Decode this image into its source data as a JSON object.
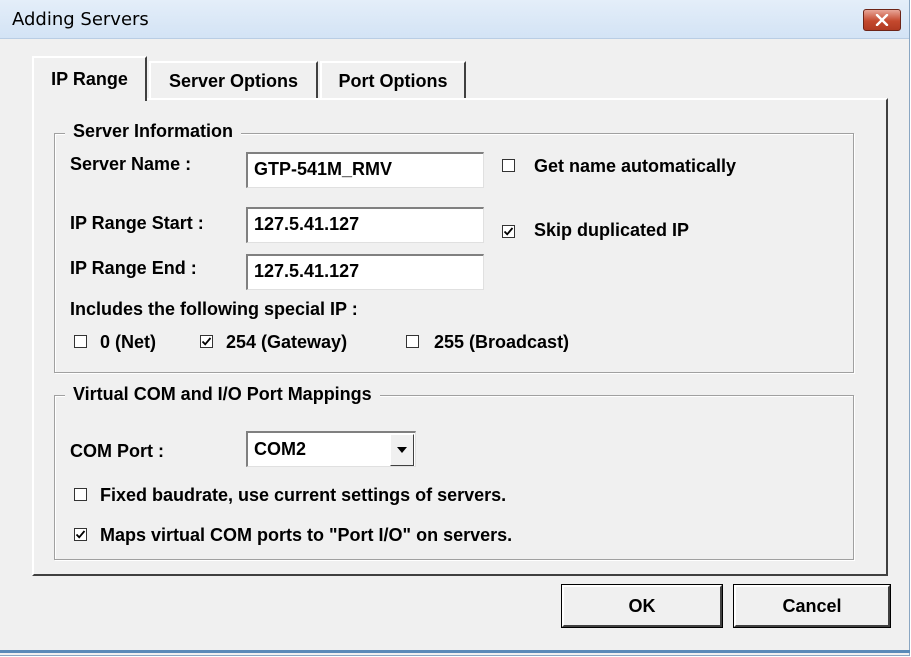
{
  "window": {
    "title": "Adding Servers"
  },
  "tabs": [
    {
      "label": "IP Range",
      "active": true
    },
    {
      "label": "Server Options",
      "active": false
    },
    {
      "label": "Port Options",
      "active": false
    }
  ],
  "server_info": {
    "legend": "Server Information",
    "server_name_label": "Server Name :",
    "server_name_value": "GTP-541M_RMV",
    "get_name_auto_label": "Get name automatically",
    "get_name_auto_checked": false,
    "ip_start_label": "IP Range Start :",
    "ip_start_value": "127.5.41.127",
    "skip_dup_label": "Skip duplicated IP",
    "skip_dup_checked": true,
    "ip_end_label": "IP Range End :",
    "ip_end_value": "127.5.41.127",
    "special_ip_label": "Includes the following special IP :",
    "special_ips": [
      {
        "label": "0 (Net)",
        "checked": false
      },
      {
        "label": "254 (Gateway)",
        "checked": true
      },
      {
        "label": "255 (Broadcast)",
        "checked": false
      }
    ]
  },
  "com_mapping": {
    "legend": "Virtual COM and I/O Port Mappings",
    "com_port_label": "COM Port :",
    "com_port_value": "COM2",
    "fixed_baud_label": "Fixed baudrate, use current settings of servers.",
    "fixed_baud_checked": false,
    "maps_port_io_label": "Maps virtual COM ports to \"Port I/O\" on servers.",
    "maps_port_io_checked": true
  },
  "buttons": {
    "ok": "OK",
    "cancel": "Cancel"
  },
  "colors": {
    "titlebar": "#d3e3f5",
    "close_button": "#c4492e",
    "dialog_face": "#f0f0f0"
  }
}
